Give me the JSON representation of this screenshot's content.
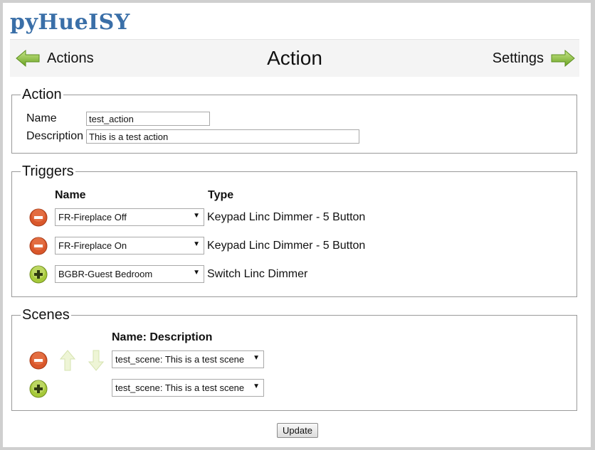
{
  "app": {
    "logo": "pyHueISY"
  },
  "nav": {
    "back_label": "Actions",
    "title": "Action",
    "forward_label": "Settings"
  },
  "action_section": {
    "legend": "Action",
    "name_label": "Name",
    "name_value": "test_action",
    "description_label": "Description",
    "description_value": "This is a test action"
  },
  "triggers_section": {
    "legend": "Triggers",
    "col_name": "Name",
    "col_type": "Type",
    "rows": [
      {
        "action": "remove",
        "selected": "FR-Fireplace Off",
        "type": "Keypad Linc Dimmer - 5 Button"
      },
      {
        "action": "remove",
        "selected": "FR-Fireplace On",
        "type": "Keypad Linc Dimmer - 5 Button"
      },
      {
        "action": "add",
        "selected": "BGBR-Guest Bedroom",
        "type": "Switch Linc Dimmer"
      }
    ]
  },
  "scenes_section": {
    "legend": "Scenes",
    "col_name": "Name: Description",
    "rows": [
      {
        "action": "remove",
        "selected": "test_scene: This is a test scene"
      },
      {
        "action": "add",
        "selected": "test_scene: This is a test scene"
      }
    ]
  },
  "update_label": "Update",
  "colors": {
    "logo": "#3a6fa8",
    "arrow_green": "#8cc63f",
    "remove_red": "#d9572b",
    "add_green": "#a6c93a"
  }
}
